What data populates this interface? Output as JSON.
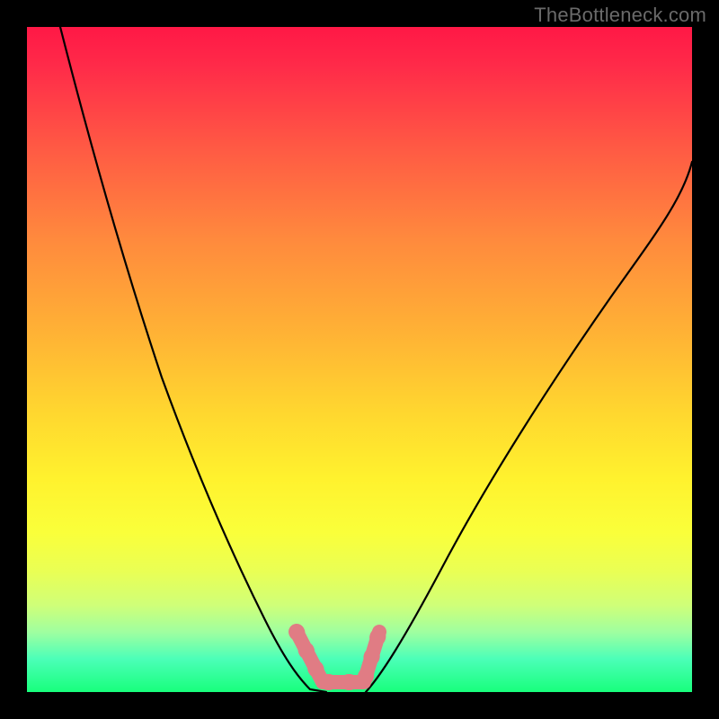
{
  "watermark": "TheBottleneck.com",
  "chart_data": {
    "type": "line",
    "title": "",
    "xlabel": "",
    "ylabel": "",
    "xlim": [
      0,
      100
    ],
    "ylim": [
      0,
      100
    ],
    "gradient_stops": [
      {
        "pct": 0,
        "color": "#ff1846"
      },
      {
        "pct": 6,
        "color": "#ff2b49"
      },
      {
        "pct": 18,
        "color": "#ff5944"
      },
      {
        "pct": 32,
        "color": "#ff8a3d"
      },
      {
        "pct": 46,
        "color": "#ffb235"
      },
      {
        "pct": 58,
        "color": "#ffd72f"
      },
      {
        "pct": 68,
        "color": "#fff22e"
      },
      {
        "pct": 76,
        "color": "#faff3a"
      },
      {
        "pct": 82,
        "color": "#e9ff55"
      },
      {
        "pct": 87,
        "color": "#cfff79"
      },
      {
        "pct": 91,
        "color": "#9fffa0"
      },
      {
        "pct": 95,
        "color": "#4cffb8"
      },
      {
        "pct": 100,
        "color": "#18ff7c"
      }
    ],
    "series": [
      {
        "name": "left-curve",
        "stroke": "#000000",
        "x": [
          5,
          8,
          12,
          16,
          20,
          24,
          28,
          31,
          34,
          37,
          39,
          41,
          43,
          45
        ],
        "y": [
          100,
          88,
          74,
          61,
          50,
          40,
          31,
          24,
          18,
          13,
          9,
          6,
          3,
          0
        ]
      },
      {
        "name": "right-curve",
        "stroke": "#000000",
        "x": [
          51,
          54,
          58,
          63,
          69,
          76,
          84,
          92,
          100
        ],
        "y": [
          0,
          6,
          14,
          24,
          35,
          47,
          59,
          70,
          80
        ]
      },
      {
        "name": "pink-marker-shape",
        "stroke": "#e07c84",
        "fill": "none",
        "x": [
          40.5,
          44.5,
          50.5,
          53.0
        ],
        "y": [
          9.0,
          1.5,
          1.5,
          9.0
        ]
      }
    ]
  }
}
